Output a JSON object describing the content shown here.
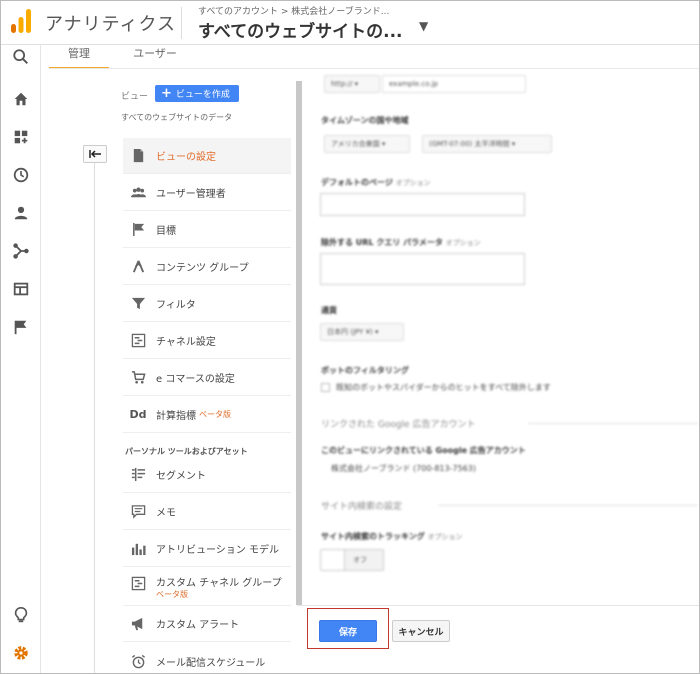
{
  "header": {
    "app_title": "アナリティクス",
    "account_path": "すべてのアカウント > 株式会社ノーブランド...",
    "view_selector": "すべてのウェブサイトの..."
  },
  "tabs": [
    {
      "label": "管理"
    },
    {
      "label": "ユーザー"
    }
  ],
  "sidebar": {
    "view_label": "ビュー",
    "create_view_label": "ビューを作成",
    "property_label": "すべてのウェブサイトのデータ",
    "items": [
      {
        "label": "ビューの設定",
        "icon": "document-icon"
      },
      {
        "label": "ユーザー管理者",
        "icon": "users-icon"
      },
      {
        "label": "目標",
        "icon": "flag-icon"
      },
      {
        "label": "コンテンツ グループ",
        "icon": "content-group-icon"
      },
      {
        "label": "フィルタ",
        "icon": "filter-icon"
      },
      {
        "label": "チャネル設定",
        "icon": "channel-icon"
      },
      {
        "label": "e コマースの設定",
        "icon": "cart-icon"
      },
      {
        "label": "計算指標",
        "icon": "dd-icon",
        "beta": "ベータ版"
      }
    ],
    "personal_section_title": "パーソナル ツールおよびアセット",
    "personal_items": [
      {
        "label": "セグメント",
        "icon": "segment-icon"
      },
      {
        "label": "メモ",
        "icon": "memo-icon"
      },
      {
        "label": "アトリビューション モデル",
        "icon": "attribution-icon"
      },
      {
        "label": "カスタム チャネル グループ",
        "icon": "custom-channel-icon",
        "beta": "ベータ版"
      },
      {
        "label": "カスタム アラート",
        "icon": "megaphone-icon"
      },
      {
        "label": "メール配信スケジュール",
        "icon": "alarm-icon"
      }
    ]
  },
  "form": {
    "url_scheme": "http:// ▾",
    "url_value": "example.co.jp",
    "timezone_label": "タイムゾーンの国や地域",
    "timezone_country": "アメリカ合衆国 ▾",
    "timezone_value": "(GMT-07:00) 太平洋時間 ▾",
    "default_page_label": "デフォルトのページ",
    "optional": "オプション",
    "exclude_params_label": "除外する URL クエリ パラメータ",
    "currency_label": "通貨",
    "currency_value": "日本円 (JPY ¥) ▾",
    "bot_filter_label": "ボットのフィルタリング",
    "bot_filter_check": "既知のボットやスパイダーからのヒットをすべて除外します",
    "linked_ads_title": "リンクされた Google 広告アカウント",
    "linked_ads_sub": "このビューにリンクされている Google 広告アカウント",
    "linked_ads_value": "株式会社ノーブランド (700-813-7563)",
    "site_search_title": "サイト内検索の設定",
    "site_search_label": "サイト内検索のトラッキング",
    "toggle_label": "オフ"
  },
  "buttons": {
    "save": "保存",
    "cancel": "キャンセル"
  },
  "colors": {
    "accent_blue": "#4285f4",
    "active_orange": "#e06c2a",
    "tab_underline": "#f4a72a",
    "highlight_red": "#c0392b"
  }
}
